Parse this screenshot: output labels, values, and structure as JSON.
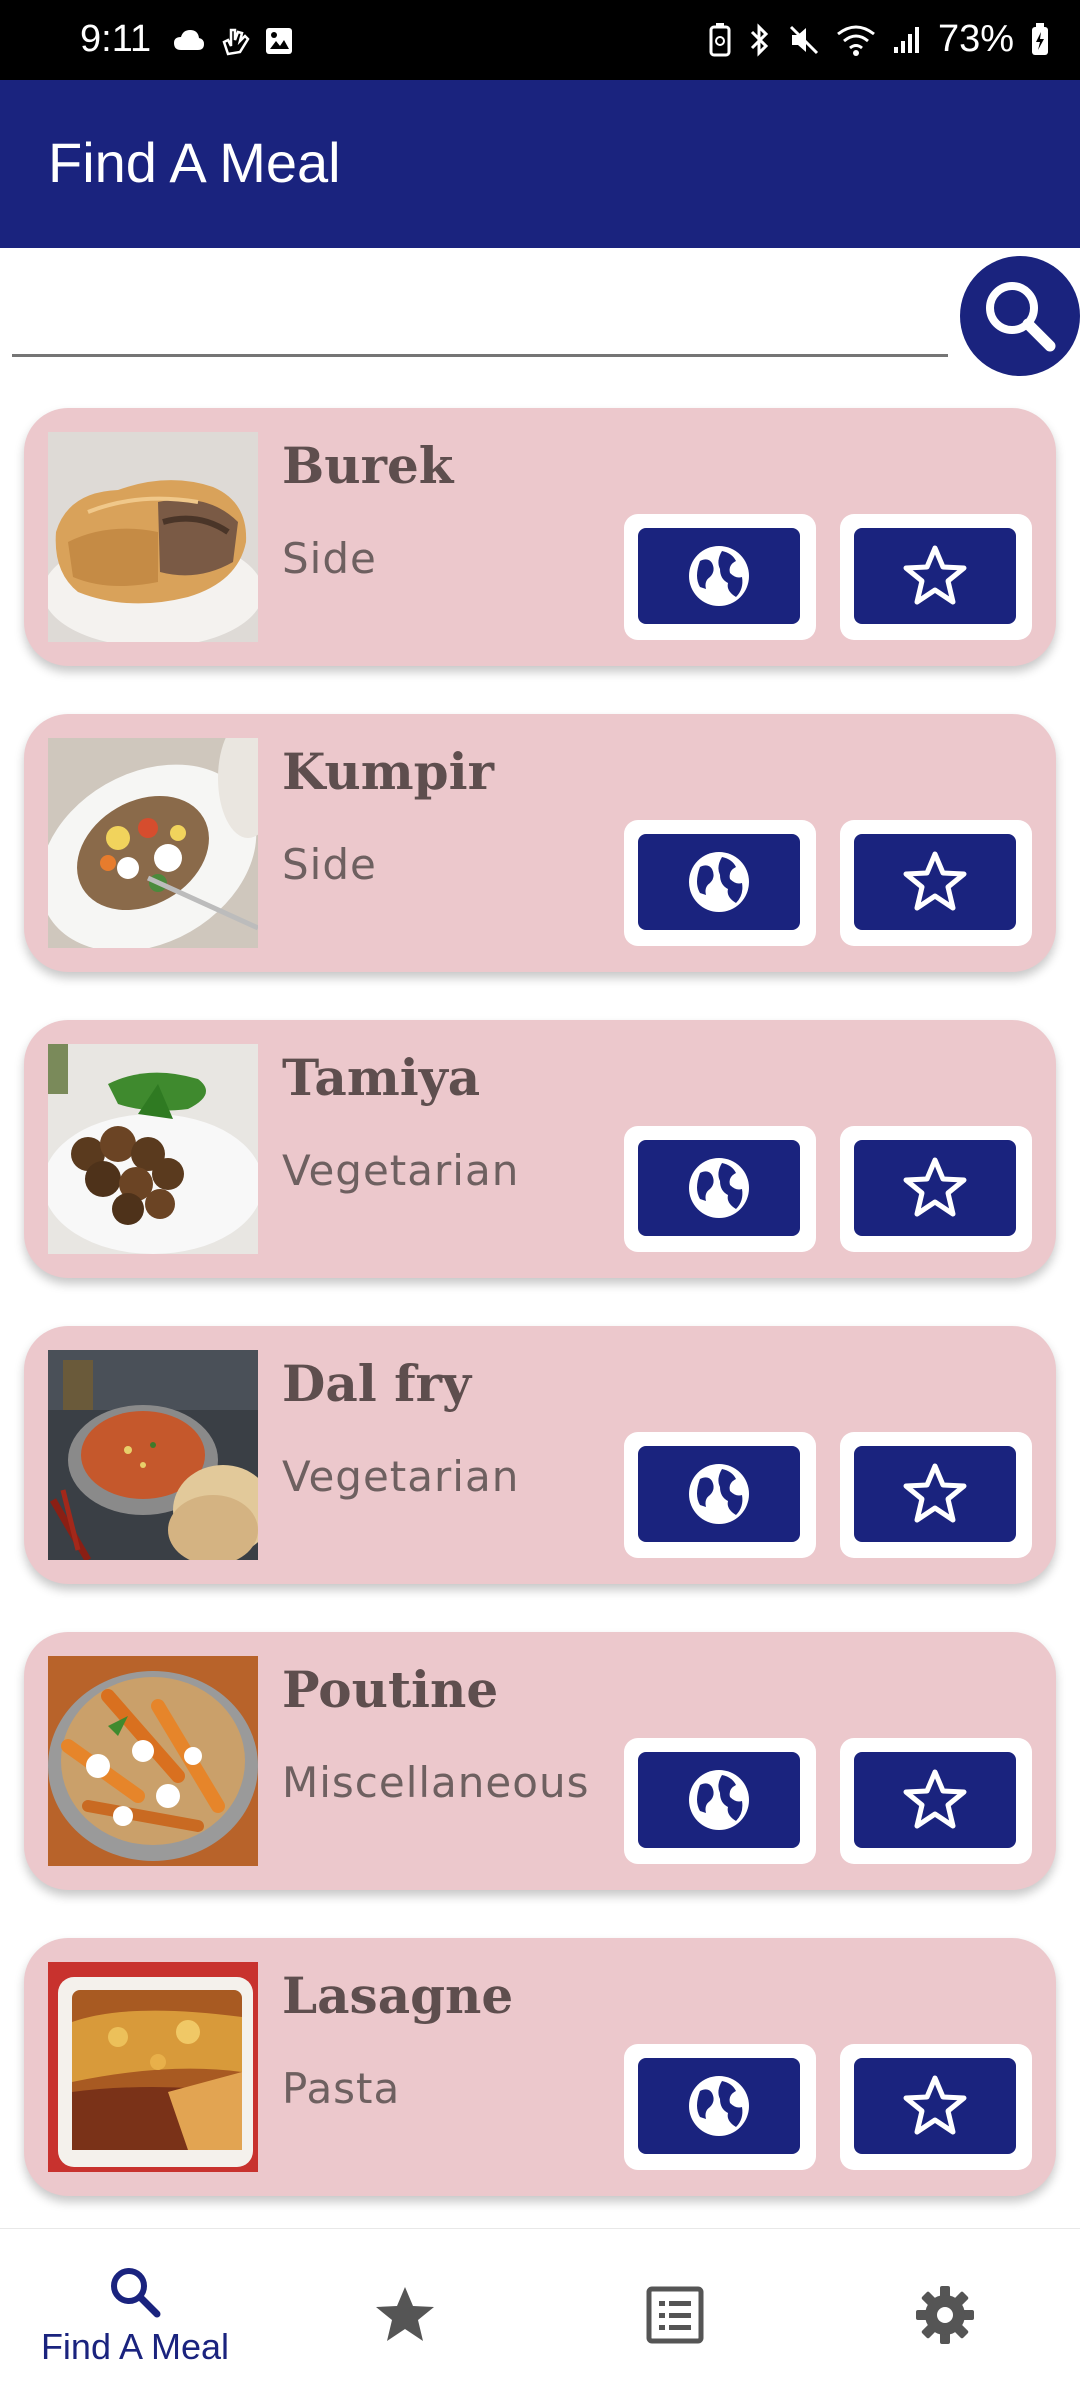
{
  "status_bar": {
    "time": "9:11",
    "battery": "73%"
  },
  "app_bar": {
    "title": "Find A Meal"
  },
  "search": {
    "value": "",
    "placeholder": ""
  },
  "meals": [
    {
      "name": "Burek",
      "category": "Side"
    },
    {
      "name": "Kumpir",
      "category": "Side"
    },
    {
      "name": "Tamiya",
      "category": "Vegetarian"
    },
    {
      "name": "Dal fry",
      "category": "Vegetarian"
    },
    {
      "name": "Poutine",
      "category": "Miscellaneous"
    },
    {
      "name": "Lasagne",
      "category": "Pasta"
    }
  ],
  "bottom_nav": [
    {
      "label": "Find A Meal",
      "icon": "search-icon",
      "selected": true
    },
    {
      "label": "",
      "icon": "star-icon",
      "selected": false
    },
    {
      "label": "",
      "icon": "list-icon",
      "selected": false
    },
    {
      "label": "",
      "icon": "gear-icon",
      "selected": false
    }
  ],
  "colors": {
    "primary": "#1a237e",
    "card": "#ecc8cc",
    "status_bar": "#000000"
  }
}
